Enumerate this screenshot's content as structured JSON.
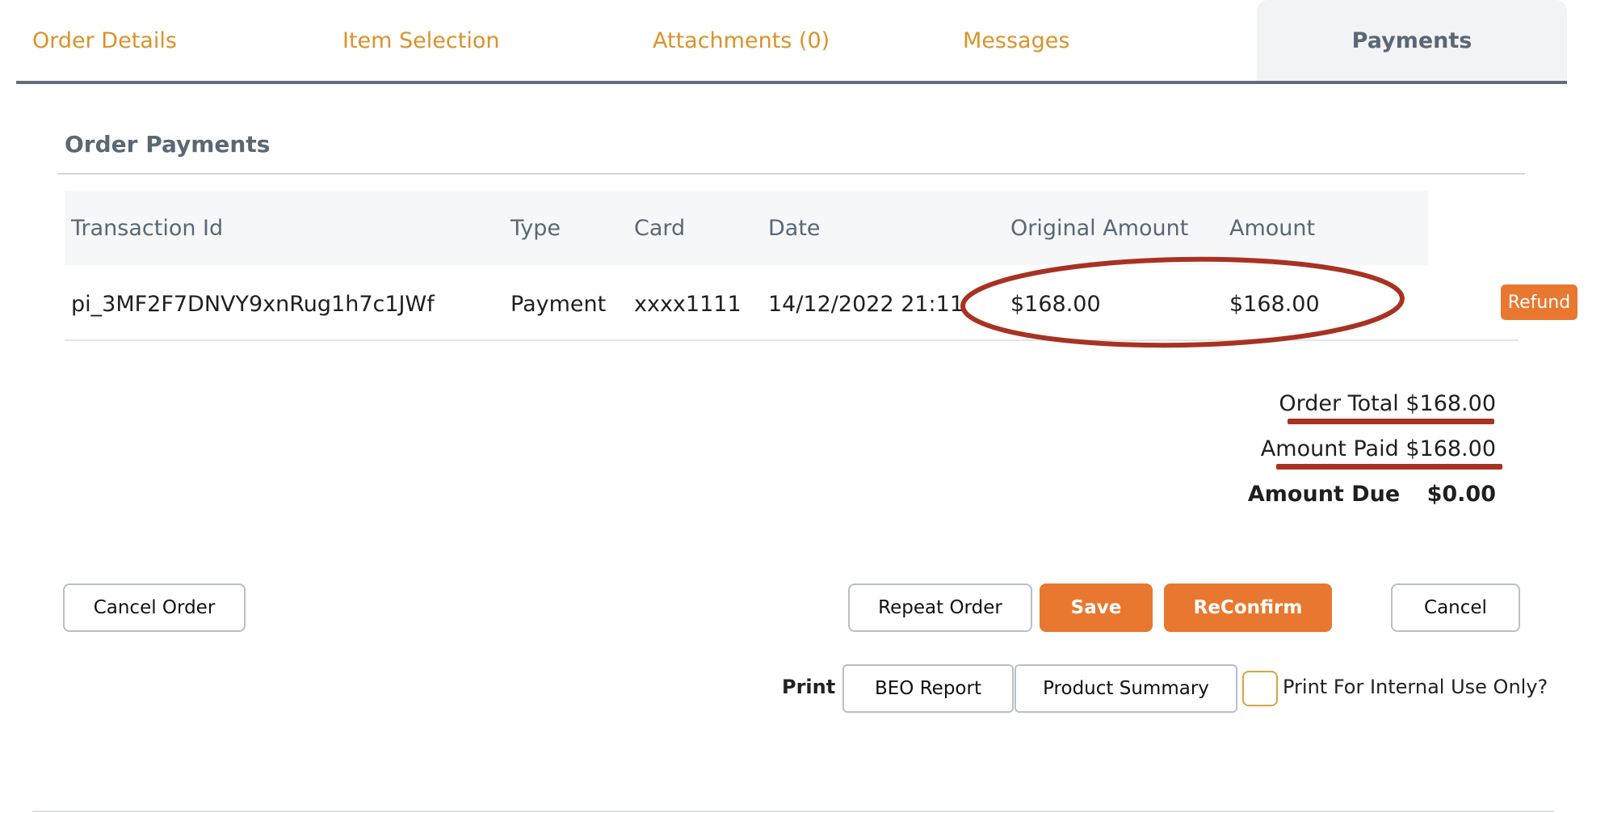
{
  "tabs": [
    {
      "label": "Order Details"
    },
    {
      "label": "Item Selection"
    },
    {
      "label": "Attachments (0)"
    },
    {
      "label": "Messages"
    },
    {
      "label": "Payments",
      "active": true
    }
  ],
  "section": {
    "title": "Order Payments"
  },
  "table": {
    "headers": [
      "Transaction Id",
      "Type",
      "Card",
      "Date",
      "Original Amount",
      "Amount"
    ],
    "rows": [
      {
        "transaction_id": "pi_3MF2F7DNVY9xnRug1h7c1JWf",
        "type": "Payment",
        "card": "xxxx1111",
        "date": "14/12/2022 21:11",
        "original_amount": "$168.00",
        "amount": "$168.00",
        "action_label": "Refund"
      }
    ]
  },
  "totals": {
    "order_total_label": "Order Total",
    "order_total_value": "$168.00",
    "amount_paid_label": "Amount Paid",
    "amount_paid_value": "$168.00",
    "amount_due_label": "Amount Due",
    "amount_due_value": "$0.00"
  },
  "actions": {
    "cancel_order": "Cancel Order",
    "repeat_order": "Repeat Order",
    "save": "Save",
    "reconfirm": "ReConfirm",
    "cancel": "Cancel"
  },
  "print": {
    "label": "Print",
    "beo_report": "BEO Report",
    "product_summary": "Product Summary",
    "internal_use_label": "Print For Internal Use Only?"
  },
  "colors": {
    "accent_orange": "#e8782f",
    "tab_inactive": "#d9932a",
    "tab_active": "#5a6775",
    "annotation_red": "#a83222"
  }
}
